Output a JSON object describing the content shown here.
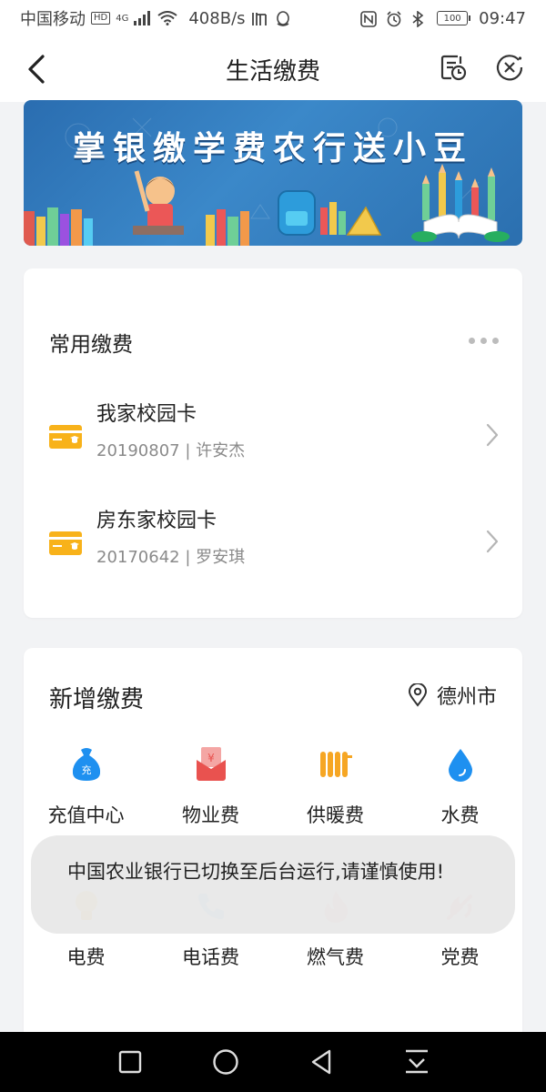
{
  "status_bar": {
    "carrier": "中国移动",
    "hd": "HD",
    "net": "4G",
    "speed": "408B/s",
    "battery": "100",
    "time": "09:47",
    "icons": [
      "signal-icon",
      "wifi-icon",
      "listen-icon",
      "qq-icon",
      "nfc-icon",
      "alarm-icon",
      "bluetooth-icon",
      "battery-icon"
    ]
  },
  "header": {
    "title": "生活缴费"
  },
  "banner": {
    "text": "掌银缴学费农行送小豆"
  },
  "common": {
    "title": "常用缴费",
    "items": [
      {
        "name": "我家校园卡",
        "sub": "20190807 | 许安杰"
      },
      {
        "name": "房东家校园卡",
        "sub": "20170642 | 罗安琪"
      }
    ]
  },
  "new_bill": {
    "title": "新增缴费",
    "city": "德州市",
    "items": [
      {
        "label": "充值中心",
        "icon": "recharge-bag-icon",
        "recharge_char": "充"
      },
      {
        "label": "物业费",
        "icon": "property-fee-icon",
        "yen": "¥"
      },
      {
        "label": "供暖费",
        "icon": "radiator-icon"
      },
      {
        "label": "水费",
        "icon": "water-drop-icon"
      },
      {
        "label": "电费",
        "icon": "lightbulb-icon"
      },
      {
        "label": "电话费",
        "icon": "phone-icon"
      },
      {
        "label": "燃气费",
        "icon": "flame-icon"
      },
      {
        "label": "党费",
        "icon": "party-emblem-icon"
      }
    ]
  },
  "toast": {
    "text": "中国农业银行已切换至后台运行,请谨慎使用!"
  },
  "colors": {
    "accent_blue": "#1e90f0",
    "accent_orange": "#f6a623",
    "accent_red": "#e9524f",
    "card_yellow": "#f8b21a"
  }
}
